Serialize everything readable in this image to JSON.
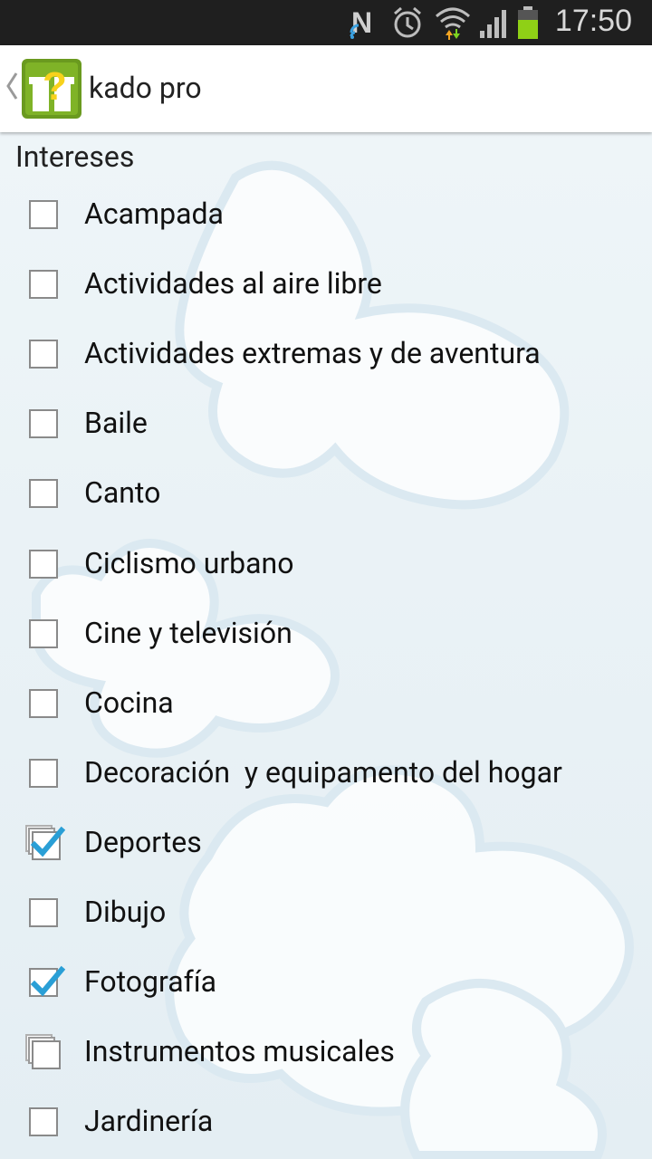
{
  "status_bar": {
    "time": "17:50",
    "icons": [
      "nfc-icon",
      "alarm-icon",
      "wifi-icon",
      "signal-icon",
      "battery-icon"
    ]
  },
  "action_bar": {
    "title": "kado pro",
    "logo_icon": "gift-question-icon",
    "accent_color": "#6a9a1f"
  },
  "section": {
    "title": "Intereses"
  },
  "interests": [
    {
      "label": "Acampada",
      "state": "unchecked"
    },
    {
      "label": "Actividades al aire libre",
      "state": "unchecked"
    },
    {
      "label": "Actividades extremas y de aventura",
      "state": "unchecked"
    },
    {
      "label": "Baile",
      "state": "unchecked"
    },
    {
      "label": "Canto",
      "state": "unchecked"
    },
    {
      "label": "Ciclismo urbano",
      "state": "unchecked"
    },
    {
      "label": "Cine y televisión",
      "state": "unchecked"
    },
    {
      "label": "Cocina",
      "state": "unchecked"
    },
    {
      "label": "Decoración  y equipamento del hogar",
      "state": "unchecked"
    },
    {
      "label": "Deportes",
      "state": "multi-checked"
    },
    {
      "label": "Dibujo",
      "state": "unchecked"
    },
    {
      "label": "Fotografía",
      "state": "checked"
    },
    {
      "label": "Instrumentos musicales",
      "state": "multi-unchecked"
    },
    {
      "label": "Jardinería",
      "state": "unchecked"
    }
  ],
  "colors": {
    "check_blue": "#2a9fd6",
    "status_bar_bg": "#1f1f1f",
    "battery_green": "#8fd016"
  }
}
